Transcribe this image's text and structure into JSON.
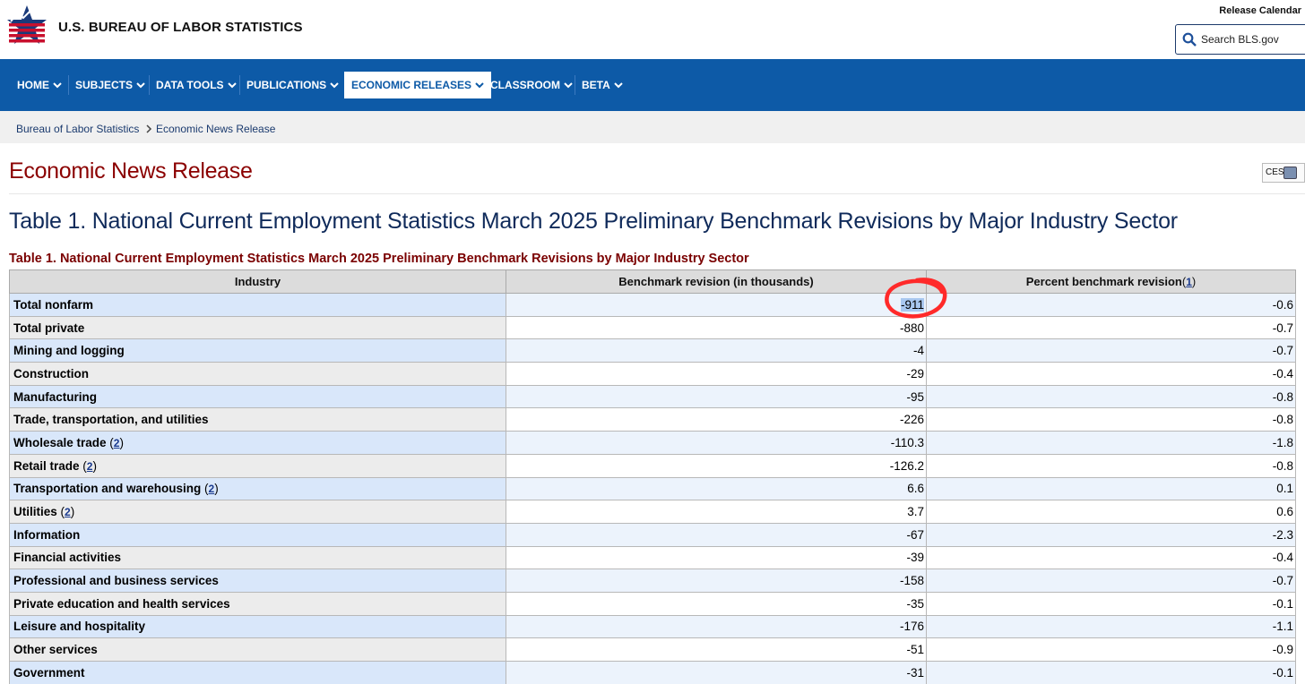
{
  "header": {
    "brand": "U.S. BUREAU OF LABOR STATISTICS",
    "release_calendar": "Release Calendar",
    "search_placeholder": "Search BLS.gov"
  },
  "nav": {
    "items": [
      {
        "label": "HOME"
      },
      {
        "label": "SUBJECTS"
      },
      {
        "label": "DATA TOOLS"
      },
      {
        "label": "PUBLICATIONS"
      },
      {
        "label": "ECONOMIC RELEASES"
      },
      {
        "label": "CLASSROOM"
      },
      {
        "label": "BETA"
      }
    ]
  },
  "breadcrumb": {
    "items": [
      "Bureau of Labor Statistics",
      "Economic News Release"
    ],
    "separator": ">"
  },
  "page": {
    "title": "Economic News Release",
    "ces_tab": "CES",
    "table_heading": "Table 1. National Current Employment Statistics March 2025 Preliminary Benchmark Revisions by Major Industry Sector",
    "table_caption": "Table 1. National Current Employment Statistics March 2025 Preliminary Benchmark Revisions by Major Industry Sector"
  },
  "table": {
    "headers": {
      "industry": "Industry",
      "benchmark": "Benchmark revision (in thousands)",
      "percent": "Percent benchmark revision",
      "percent_fn": "1"
    },
    "rows": [
      {
        "industry": "Total nonfarm",
        "revision": "-911",
        "percent": "-0.6"
      },
      {
        "industry": "Total private",
        "revision": "-880",
        "percent": "-0.7"
      },
      {
        "industry": "Mining and logging",
        "revision": "-4",
        "percent": "-0.7"
      },
      {
        "industry": "Construction",
        "revision": "-29",
        "percent": "-0.4"
      },
      {
        "industry": "Manufacturing",
        "revision": "-95",
        "percent": "-0.8"
      },
      {
        "industry": "Trade, transportation, and utilities",
        "revision": "-226",
        "percent": "-0.8"
      },
      {
        "industry": "Wholesale trade",
        "fn": "2",
        "revision": "-110.3",
        "percent": "-1.8"
      },
      {
        "industry": "Retail trade",
        "fn": "2",
        "revision": "-126.2",
        "percent": "-0.8"
      },
      {
        "industry": "Transportation and warehousing",
        "fn": "2",
        "revision": "6.6",
        "percent": "0.1"
      },
      {
        "industry": "Utilities",
        "fn": "2",
        "revision": "3.7",
        "percent": "0.6"
      },
      {
        "industry": "Information",
        "revision": "-67",
        "percent": "-2.3"
      },
      {
        "industry": "Financial activities",
        "revision": "-39",
        "percent": "-0.4"
      },
      {
        "industry": "Professional and business services",
        "revision": "-158",
        "percent": "-0.7"
      },
      {
        "industry": "Private education and health services",
        "revision": "-35",
        "percent": "-0.1"
      },
      {
        "industry": "Leisure and hospitality",
        "revision": "-176",
        "percent": "-1.1"
      },
      {
        "industry": "Other services",
        "revision": "-51",
        "percent": "-0.9"
      },
      {
        "industry": "Government",
        "revision": "-31",
        "percent": "-0.1"
      }
    ]
  },
  "colors": {
    "nav_blue": "#0d5aa7",
    "title_red": "#8b0000",
    "annotation_red": "#ff2a2a"
  }
}
